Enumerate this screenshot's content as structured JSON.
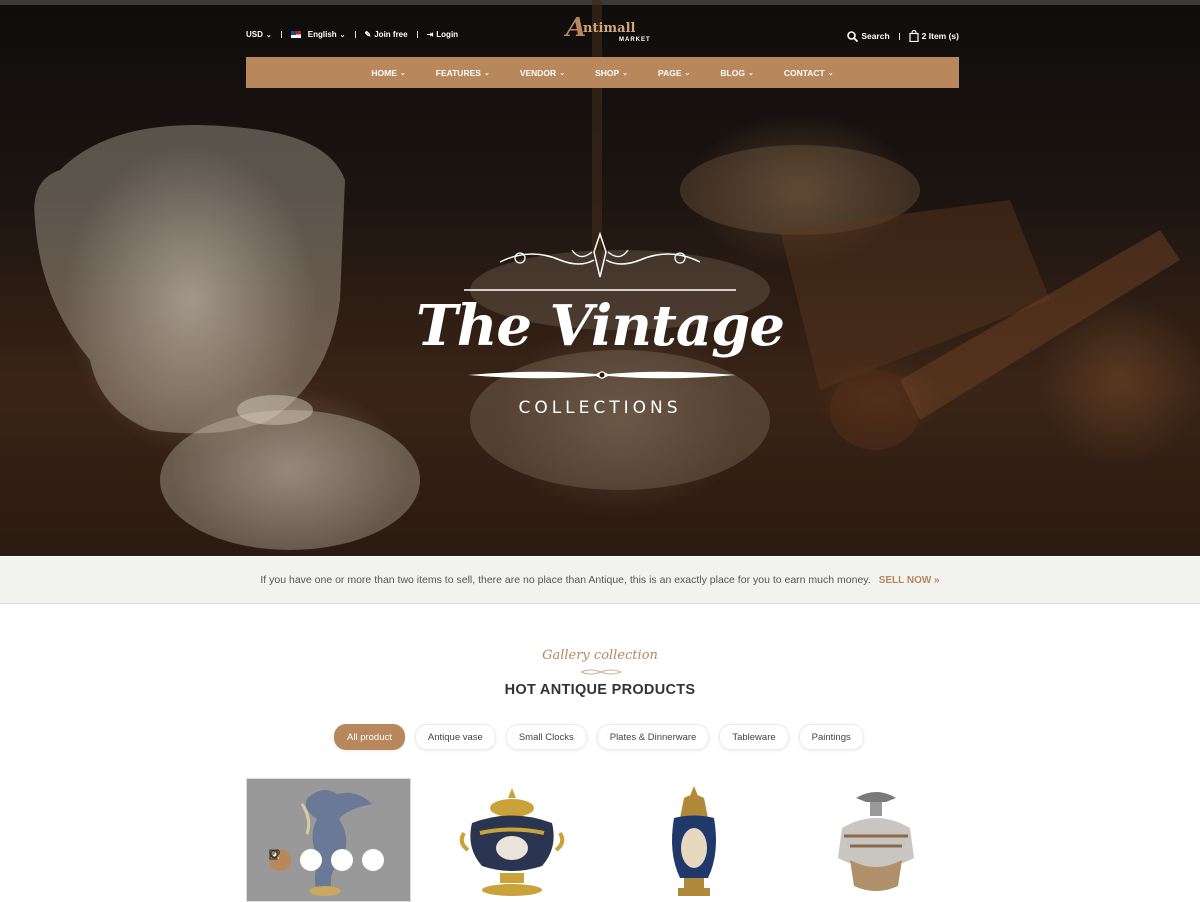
{
  "topbar": {
    "currency": "USD",
    "language": "English",
    "join": "Join free",
    "login": "Login",
    "search": "Search",
    "cart": "2 Item (s)"
  },
  "logo": {
    "initial": "A",
    "name": "ntimall",
    "sub": "MARKET"
  },
  "nav": [
    "HOME",
    "FEATURES",
    "VENDOR",
    "SHOP",
    "PAGE",
    "BLOG",
    "CONTACT"
  ],
  "hero": {
    "title": "The Vintage",
    "subtitle": "COLLECTIONS"
  },
  "strip": {
    "text": "If you have one or more than two items to sell, there are no place than Antique, this is an exactly place for you to earn much money.",
    "cta": "SELL NOW »"
  },
  "section": {
    "script": "Gallery collection",
    "title": "HOT ANTIQUE  PRODUCTS"
  },
  "filters": [
    {
      "label": "All product",
      "active": true
    },
    {
      "label": "Antique vase",
      "active": false
    },
    {
      "label": "Small Clocks",
      "active": false
    },
    {
      "label": "Plates & Dinnerware",
      "active": false
    },
    {
      "label": "Tableware",
      "active": false
    },
    {
      "label": "Paintings",
      "active": false
    }
  ],
  "colors": {
    "accent": "#b8875c",
    "strip_bg": "#f2f2ef"
  },
  "product_actions": [
    "search-icon",
    "refresh-icon",
    "heart-icon",
    "file-icon"
  ]
}
